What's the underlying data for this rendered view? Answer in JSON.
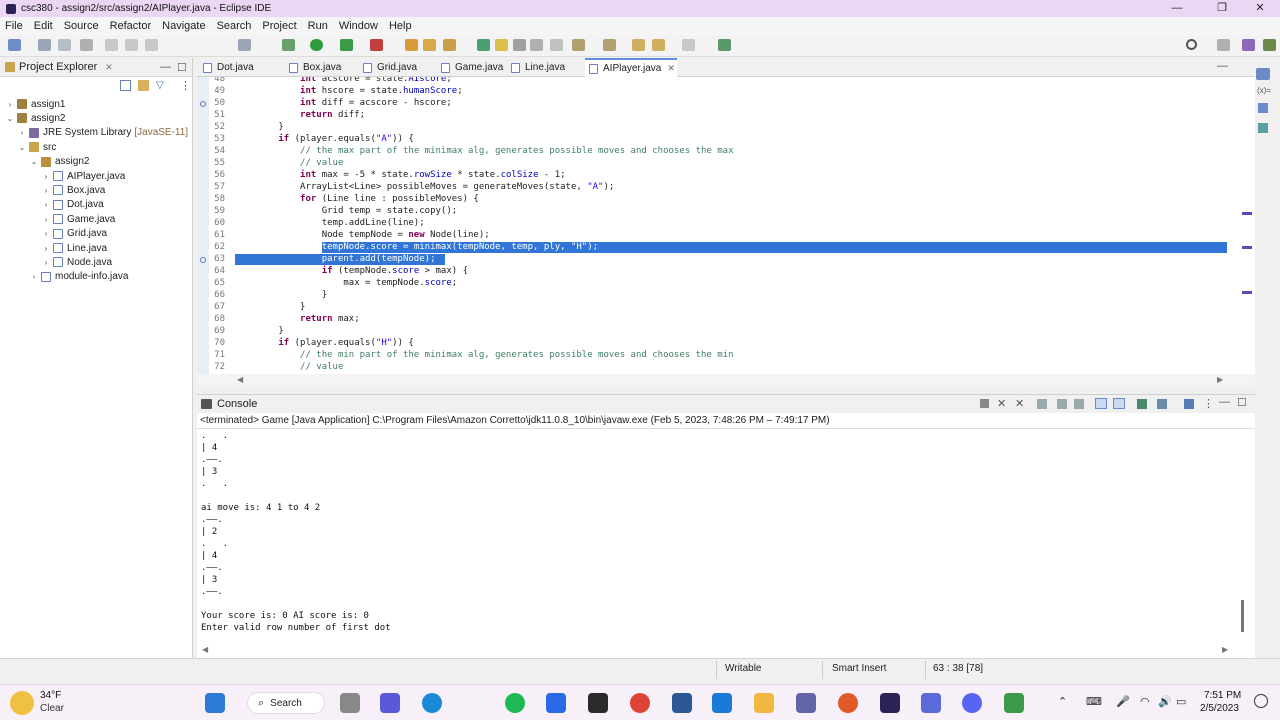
{
  "window": {
    "title": "csc380 - assign2/src/assign2/AIPlayer.java - Eclipse IDE"
  },
  "menu": [
    "File",
    "Edit",
    "Source",
    "Refactor",
    "Navigate",
    "Search",
    "Project",
    "Run",
    "Window",
    "Help"
  ],
  "project_explorer": {
    "title": "Project Explorer",
    "items": [
      {
        "label": "assign1",
        "indent": 0,
        "twisty": "›",
        "icon": "proj"
      },
      {
        "label": "assign2",
        "indent": 0,
        "twisty": "⌄",
        "icon": "proj"
      },
      {
        "label": "JRE System Library",
        "suffix": "[JavaSE-11]",
        "indent": 1,
        "twisty": "›",
        "icon": "lib"
      },
      {
        "label": "src",
        "indent": 1,
        "twisty": "⌄",
        "icon": "src"
      },
      {
        "label": "assign2",
        "indent": 2,
        "twisty": "⌄",
        "icon": "pkg"
      },
      {
        "label": "AIPlayer.java",
        "indent": 3,
        "twisty": "›",
        "icon": "java"
      },
      {
        "label": "Box.java",
        "indent": 3,
        "twisty": "›",
        "icon": "java"
      },
      {
        "label": "Dot.java",
        "indent": 3,
        "twisty": "›",
        "icon": "java"
      },
      {
        "label": "Game.java",
        "indent": 3,
        "twisty": "›",
        "icon": "java"
      },
      {
        "label": "Grid.java",
        "indent": 3,
        "twisty": "›",
        "icon": "java"
      },
      {
        "label": "Line.java",
        "indent": 3,
        "twisty": "›",
        "icon": "java"
      },
      {
        "label": "Node.java",
        "indent": 3,
        "twisty": "›",
        "icon": "java"
      },
      {
        "label": "module-info.java",
        "indent": 2,
        "twisty": "›",
        "icon": "java"
      }
    ]
  },
  "tabs": [
    "Dot.java",
    "Box.java",
    "Grid.java",
    "Game.java",
    "Line.java",
    "AIPlayer.java"
  ],
  "active_tab": "AIPlayer.java",
  "code_lines": [
    {
      "n": "48",
      "html": "            <span class=\"kw\">int</span> acscore = state.<span class=\"fd\">AIscore</span>;"
    },
    {
      "n": "49",
      "html": "            <span class=\"kw\">int</span> hscore = state.<span class=\"fd\">humanScore</span>;"
    },
    {
      "n": "50",
      "html": "            <span class=\"kw\">int</span> diff = acscore - hscore;"
    },
    {
      "n": "51",
      "html": "            <span class=\"kw\">return</span> diff;"
    },
    {
      "n": "52",
      "html": "        }"
    },
    {
      "n": "53",
      "html": "        <span class=\"kw\">if</span> (player.equals(<span class=\"st\">\"A\"</span>)) {"
    },
    {
      "n": "54",
      "html": "            <span class=\"cm\">// the max part of the minimax alg, generates possible moves and chooses the max</span>"
    },
    {
      "n": "55",
      "html": "            <span class=\"cm\">// value</span>"
    },
    {
      "n": "56",
      "html": "            <span class=\"kw\">int</span> max = -5 * state.<span class=\"fd\">rowSize</span> * state.<span class=\"fd\">colSize</span> - 1;"
    },
    {
      "n": "57",
      "html": "            ArrayList&lt;Line&gt; possibleMoves = generateMoves(state, <span class=\"st\">\"A\"</span>);"
    },
    {
      "n": "58",
      "html": "            <span class=\"kw\">for</span> (Line line : possibleMoves) {"
    },
    {
      "n": "59",
      "html": "                Grid temp = state.copy();"
    },
    {
      "n": "60",
      "html": "                temp.addLine(line);"
    },
    {
      "n": "61",
      "html": "                Node tempNode = <span class=\"kw\">new</span> Node(line);"
    },
    {
      "n": "62",
      "html": "                <span class=\"sel\">tempNode.score = minimax(tempNode, temp, ply, \"H\");</span>"
    },
    {
      "n": "63",
      "html": "<span class=\"sel\">                parent.add(tempNode);</span>"
    },
    {
      "n": "64",
      "html": "                <span class=\"kw\">if</span> (tempNode.<span class=\"fd\">score</span> &gt; max) {"
    },
    {
      "n": "65",
      "html": "                    max = tempNode.<span class=\"fd\">score</span>;"
    },
    {
      "n": "66",
      "html": "                }"
    },
    {
      "n": "67",
      "html": "            }"
    },
    {
      "n": "68",
      "html": "            <span class=\"kw\">return</span> max;"
    },
    {
      "n": "69",
      "html": "        }"
    },
    {
      "n": "70",
      "html": "        <span class=\"kw\">if</span> (player.equals(<span class=\"st\">\"H\"</span>)) {"
    },
    {
      "n": "71",
      "html": "            <span class=\"cm\">// the min part of the minimax alg, generates possible moves and chooses the min</span>"
    },
    {
      "n": "72",
      "html": "            <span class=\"cm\">// value</span>"
    }
  ],
  "console": {
    "title": "Console",
    "terminated": "<terminated> Game [Java Application] C:\\Program Files\\Amazon Corretto\\jdk11.0.8_10\\bin\\javaw.exe  (Feb 5, 2023, 7:48:26 PM – 7:49:17 PM)",
    "lines": [
      ".   .",
      "| 4",
      ".——.",
      "| 3",
      ".   .",
      "",
      "ai move is: 4 1 to 4 2",
      ".——.",
      "| 2",
      ".   .",
      "| 4",
      ".——.",
      "| 3",
      ".——.",
      "",
      "Your score is: 0 AI score is: 0",
      "Enter valid row number of first dot"
    ]
  },
  "status": {
    "writable": "Writable",
    "insert": "Smart Insert",
    "position": "63 : 38 [78]"
  },
  "taskbar": {
    "weather_temp": "34°F",
    "weather_desc": "Clear",
    "search": "Search",
    "time": "7:51 PM",
    "date": "2/5/2023"
  }
}
